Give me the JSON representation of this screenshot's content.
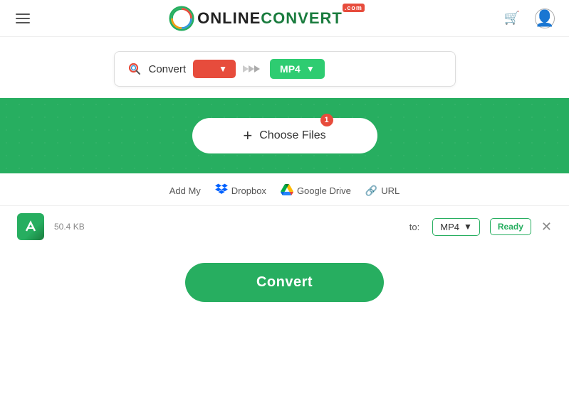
{
  "header": {
    "logo_online": "ONLINE",
    "logo_convert": "CONVERT",
    "logo_com": ".com",
    "cart_icon": "🛒",
    "user_icon": "👤"
  },
  "searchbar": {
    "convert_label": "Convert",
    "from_format": "",
    "to_format": "MP4",
    "arrows": "❯❯❯"
  },
  "dropzone": {
    "choose_files_label": "Choose Files",
    "badge_count": "1"
  },
  "addmy": {
    "label": "Add My",
    "dropbox_label": "Dropbox",
    "gdrive_label": "Google Drive",
    "url_label": "URL"
  },
  "file": {
    "size": "50.4 KB",
    "to_label": "to:",
    "format": "MP4",
    "status": "Ready"
  },
  "convert": {
    "button_label": "Convert"
  }
}
